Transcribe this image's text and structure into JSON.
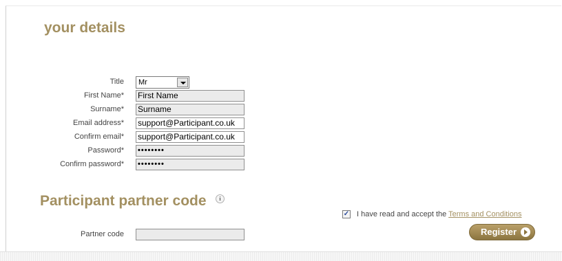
{
  "details": {
    "heading": "your details",
    "title_label": "Title",
    "title_value": "Mr",
    "first_name_label": "First Name*",
    "first_name_value": "First Name",
    "surname_label": "Surname*",
    "surname_value": "Surname",
    "email_label": "Email address*",
    "email_value": "support@Participant.co.uk",
    "confirm_email_label": "Confirm email*",
    "confirm_email_value": "support@Participant.co.uk",
    "password_label": "Password*",
    "password_value": "••••••••",
    "confirm_password_label": "Confirm password*",
    "confirm_password_value": "••••••••"
  },
  "partner": {
    "heading": "Participant partner code",
    "info_icon": "i",
    "code_label": "Partner code",
    "code_value": ""
  },
  "terms": {
    "checked": true,
    "text": "I have read and accept the ",
    "link": "Terms and Conditions"
  },
  "register": {
    "label": "Register"
  },
  "colors": {
    "accent": "#a39061",
    "button": "#8c7540"
  }
}
